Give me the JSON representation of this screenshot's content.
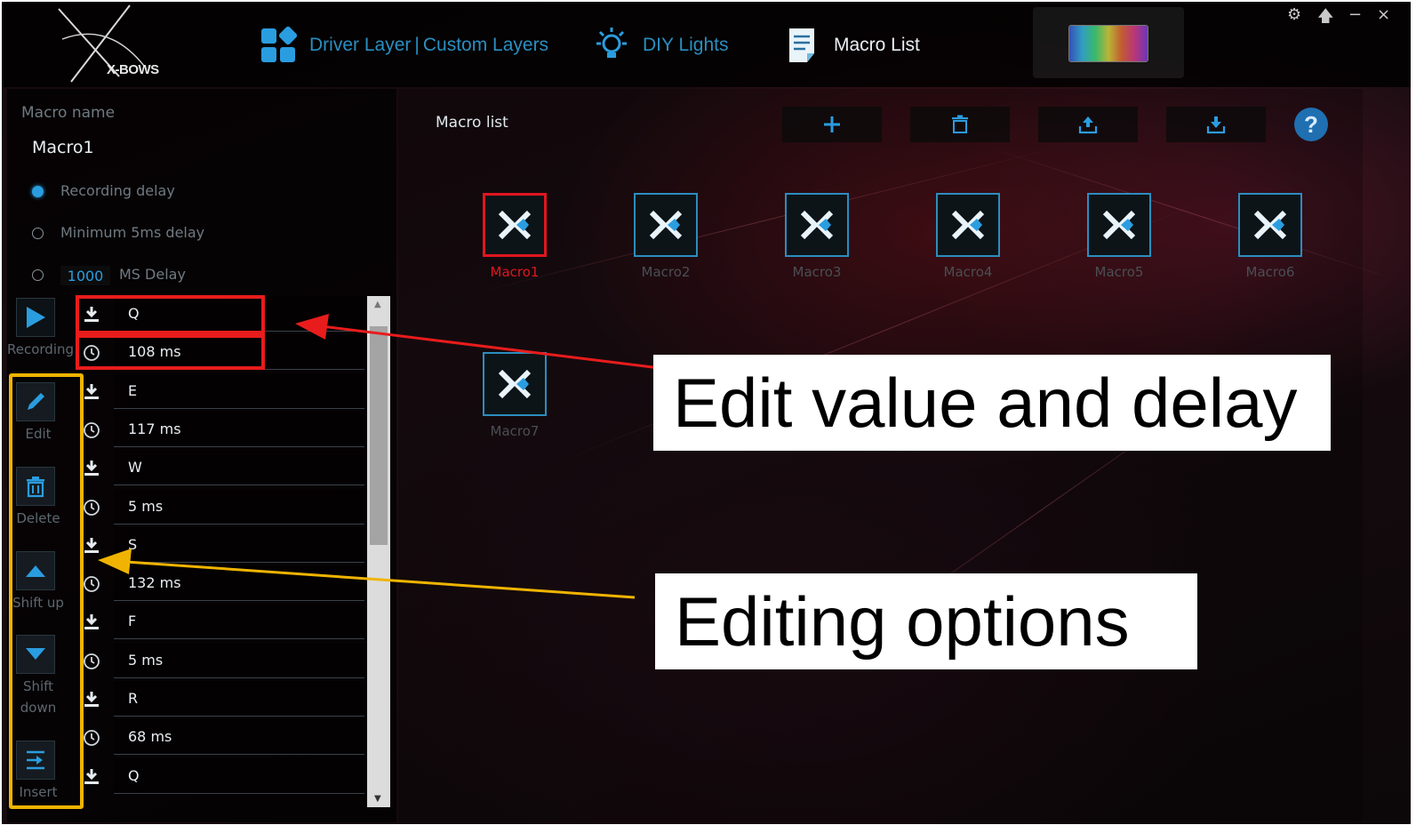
{
  "header": {
    "logo_text": "X-BOWS",
    "nav": {
      "driver_layer": "Driver Layer",
      "separator": "|",
      "custom_layers": "Custom Layers",
      "diy_lights": "DIY Lights",
      "macro_list": "Macro List"
    },
    "window_controls": {
      "settings": "⚙",
      "pin": "🡅",
      "minimize": "−",
      "close": "×"
    }
  },
  "left_panel": {
    "macro_name_label": "Macro name",
    "macro_name_value": "Macro1",
    "delay_options": [
      {
        "label": "Recording delay",
        "selected": true
      },
      {
        "label": "Minimum 5ms delay",
        "selected": false
      },
      {
        "label": "MS Delay",
        "selected": false
      }
    ],
    "ms_delay_value": "1000",
    "side_buttons": {
      "recording": "Recording",
      "edit": "Edit",
      "delete": "Delete",
      "shift_up": "Shift up",
      "shift_down_line1": "Shift",
      "shift_down_line2": "down",
      "insert": "Insert"
    },
    "steps": [
      {
        "type": "key",
        "value": "Q"
      },
      {
        "type": "delay",
        "value": "108 ms"
      },
      {
        "type": "key",
        "value": "E"
      },
      {
        "type": "delay",
        "value": "117 ms"
      },
      {
        "type": "key",
        "value": "W"
      },
      {
        "type": "delay",
        "value": "5 ms"
      },
      {
        "type": "key",
        "value": "S"
      },
      {
        "type": "delay",
        "value": "132 ms"
      },
      {
        "type": "key",
        "value": "F"
      },
      {
        "type": "delay",
        "value": "5 ms"
      },
      {
        "type": "key",
        "value": "R"
      },
      {
        "type": "delay",
        "value": "68 ms"
      },
      {
        "type": "key",
        "value": "Q"
      }
    ]
  },
  "right_panel": {
    "title": "Macro list",
    "toolbar": {
      "add_icon": "plus-icon",
      "delete_icon": "trash-icon",
      "export_icon": "upload-icon",
      "import_icon": "download-icon"
    },
    "help": "?",
    "macros": [
      "Macro1",
      "Macro2",
      "Macro3",
      "Macro4",
      "Macro5",
      "Macro6",
      "Macro7"
    ],
    "selected_macro": "Macro1"
  },
  "annotations": {
    "edit_callout": "Edit value and delay",
    "options_callout": "Editing options"
  },
  "colors": {
    "accent_blue": "#2a8ec0",
    "selected_red": "#e0161f",
    "highlight_yellow": "#f0b400",
    "annotation_red": "#e81c1c"
  }
}
